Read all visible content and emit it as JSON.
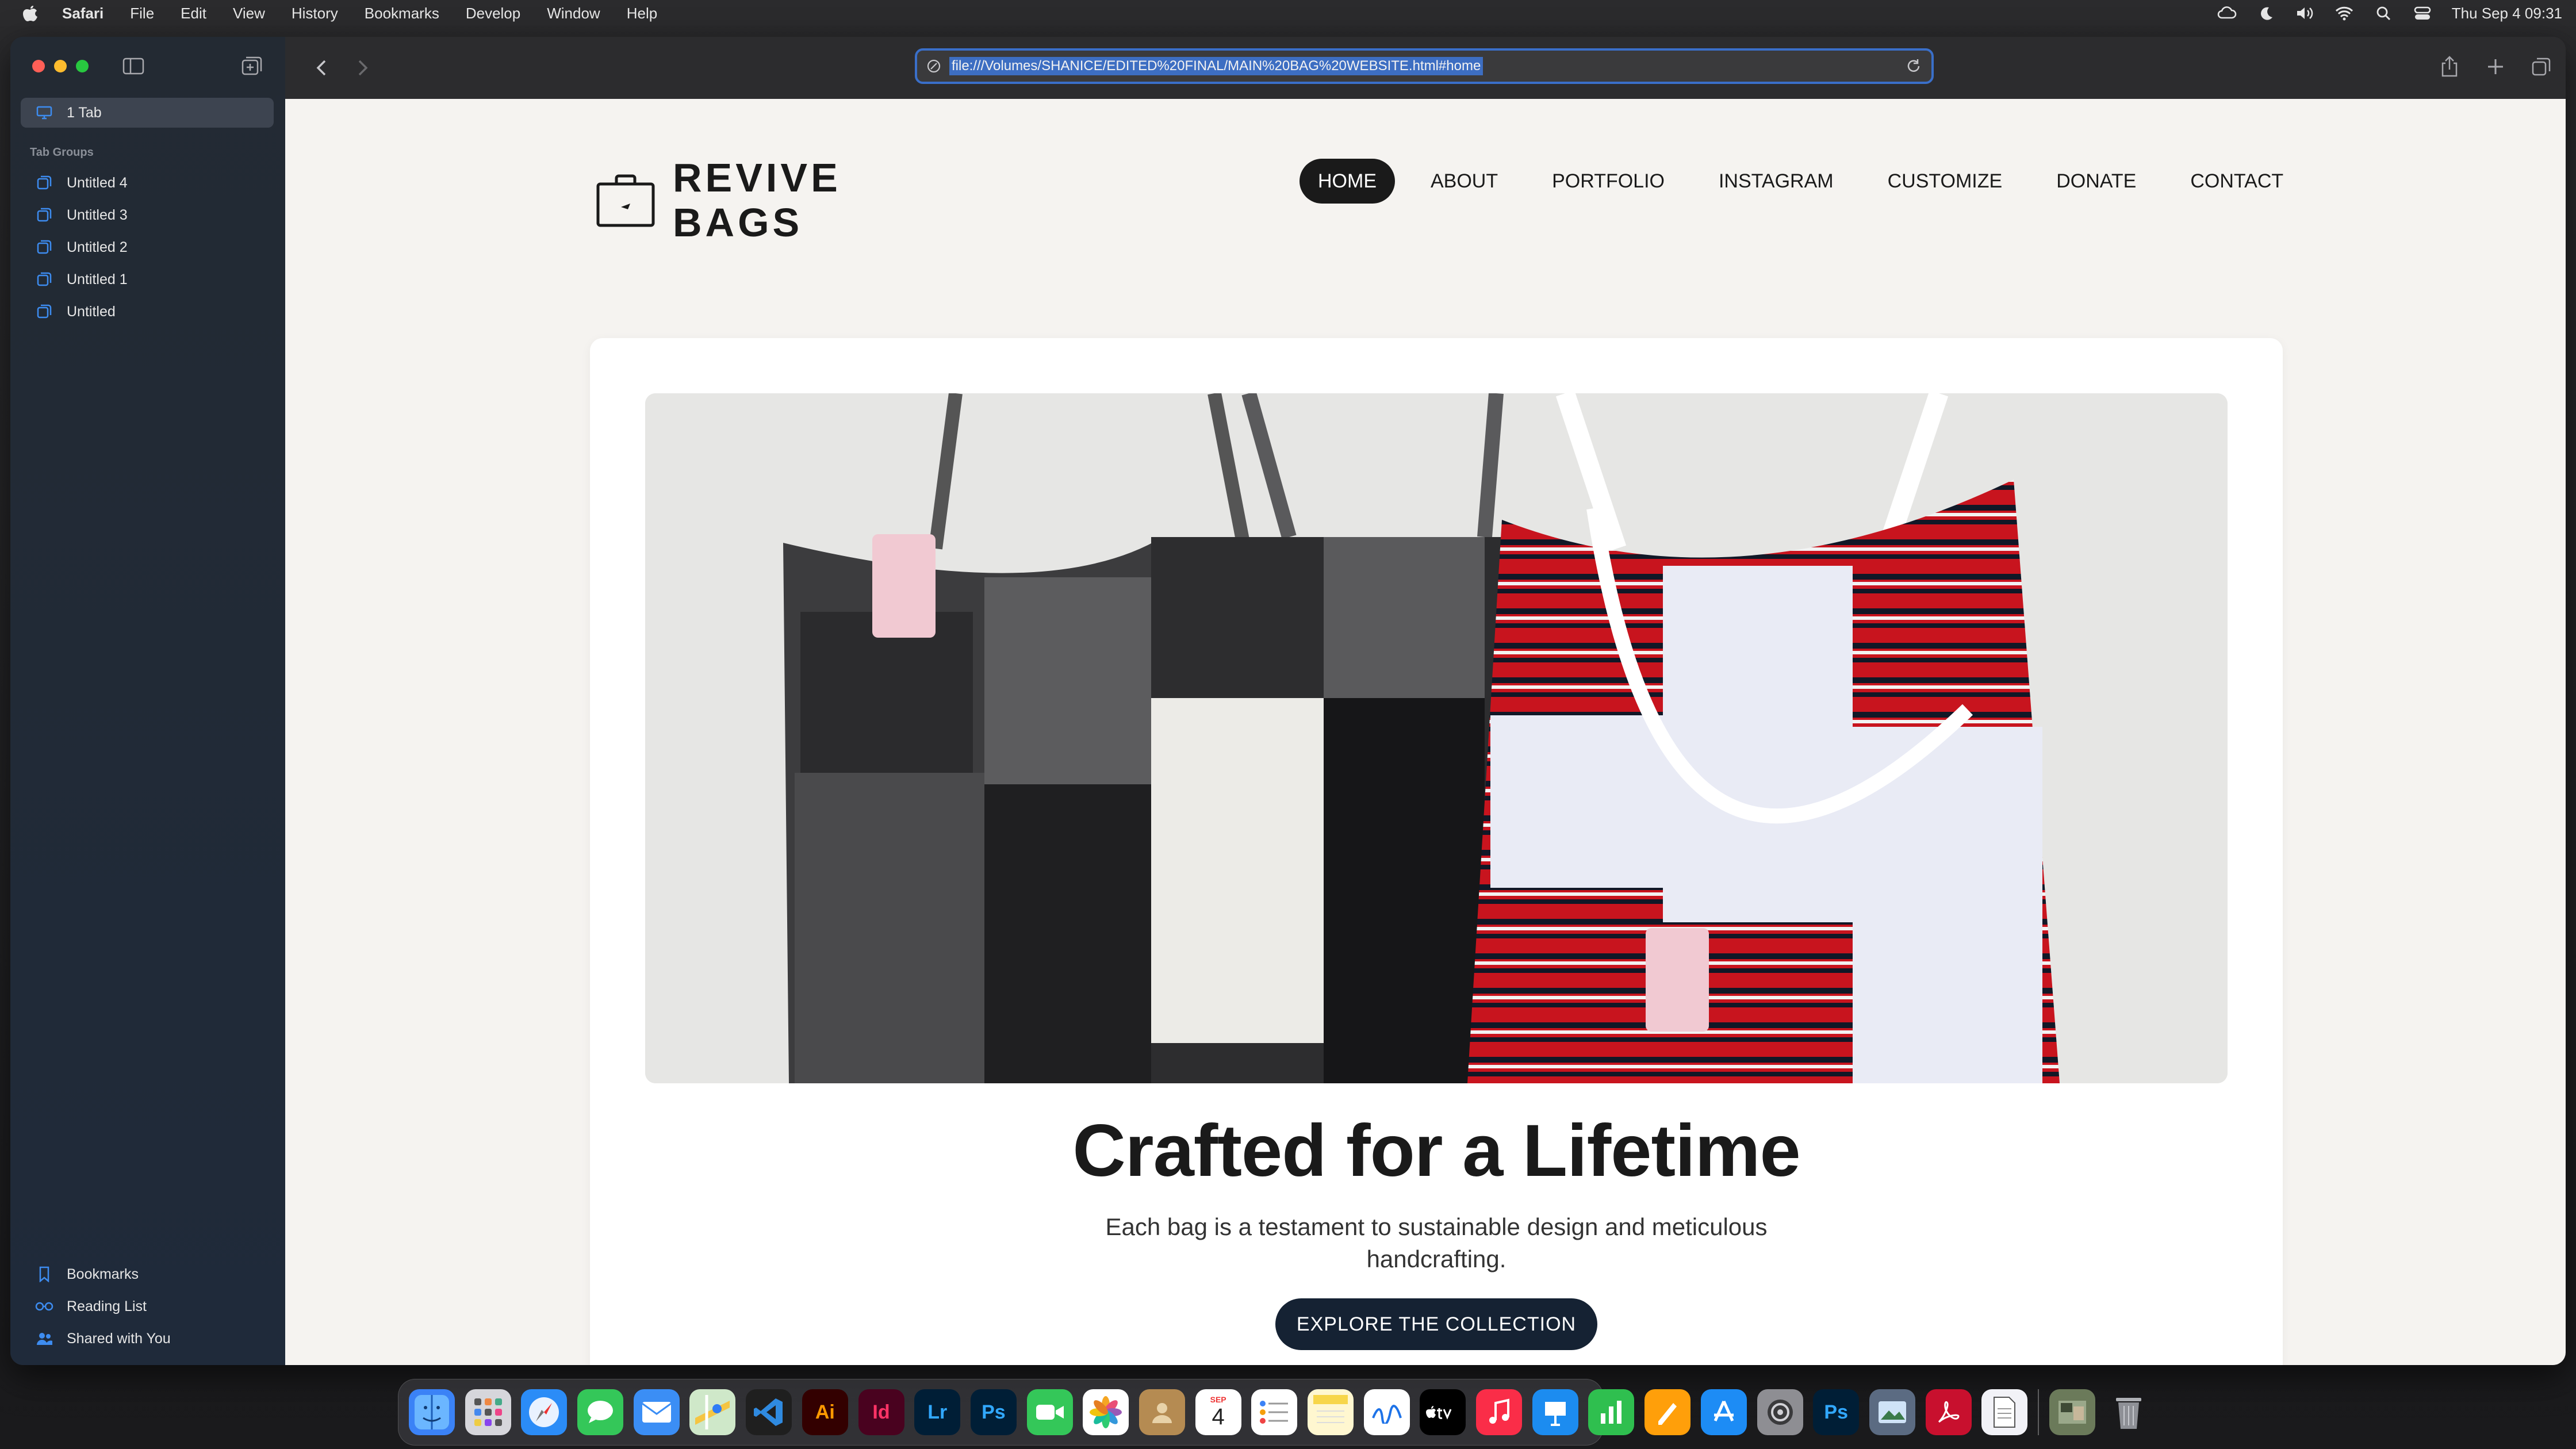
{
  "menubar": {
    "app": "Safari",
    "items": [
      "File",
      "Edit",
      "View",
      "History",
      "Bookmarks",
      "Develop",
      "Window",
      "Help"
    ],
    "datetime": "Thu Sep 4  09:31"
  },
  "sidebar": {
    "current": "1 Tab",
    "groups_heading": "Tab Groups",
    "groups": [
      "Untitled 4",
      "Untitled 3",
      "Untitled 2",
      "Untitled 1",
      "Untitled"
    ],
    "bottom": [
      "Bookmarks",
      "Reading List",
      "Shared with You"
    ]
  },
  "toolbar": {
    "url": "file:///Volumes/SHANICE/EDITED%20FINAL/MAIN%20BAG%20WEBSITE.html#home"
  },
  "site": {
    "brand_line1": "REVIVE",
    "brand_line2": "BAGS",
    "nav": [
      "HOME",
      "ABOUT",
      "PORTFOLIO",
      "INSTAGRAM",
      "CUSTOMIZE",
      "DONATE",
      "CONTACT"
    ],
    "active_nav": "HOME",
    "hero_title": "Crafted for a Lifetime",
    "hero_subtitle": "Each bag is a testament to sustainable design and meticulous handcrafting.",
    "hero_button": "EXPLORE THE COLLECTION"
  },
  "dock": {
    "calendar_month": "SEP",
    "calendar_day": "4"
  },
  "colors": {
    "accent": "#3a6fc9",
    "page_bg": "#f5f3f0",
    "button_bg": "#152233"
  }
}
